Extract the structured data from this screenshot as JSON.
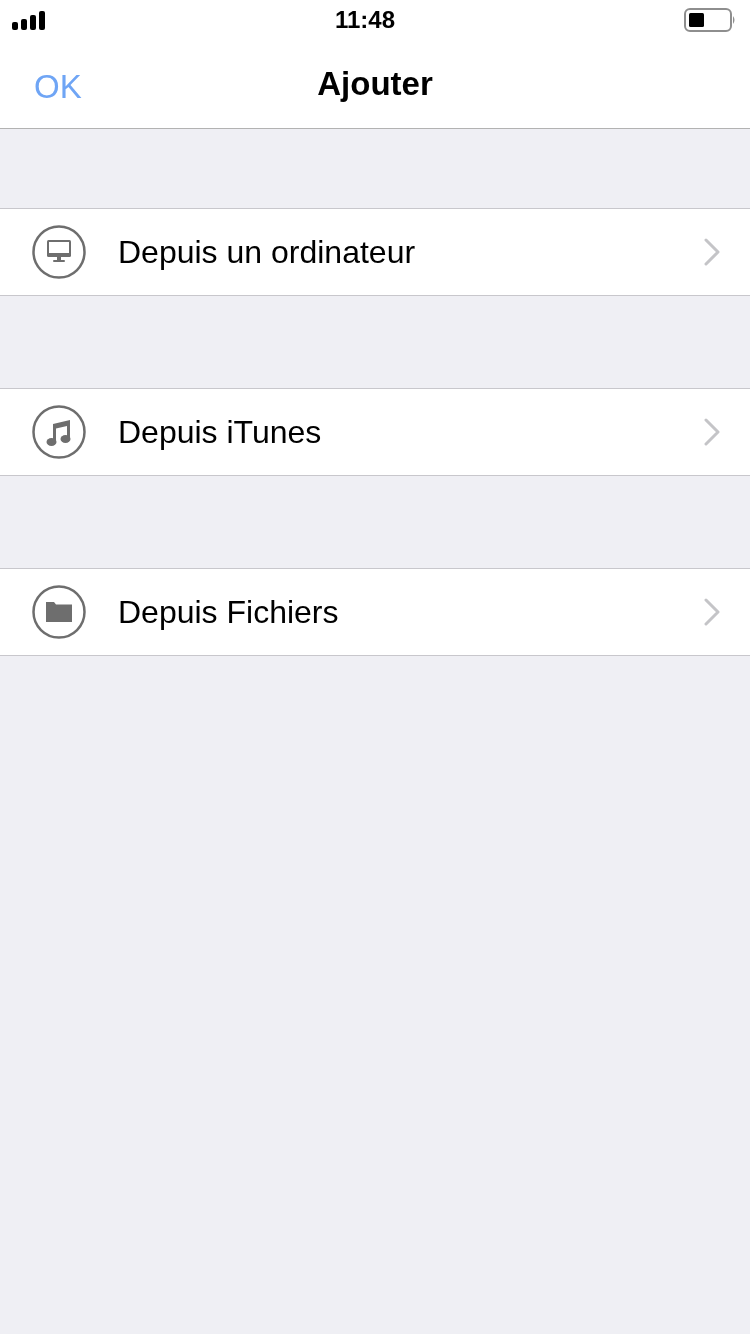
{
  "status_bar": {
    "time": "11:48"
  },
  "nav_bar": {
    "left_button": "OK",
    "title": "Ajouter"
  },
  "items": [
    {
      "kind": "computer",
      "label": "Depuis un ordinateur"
    },
    {
      "kind": "music",
      "label": "Depuis iTunes"
    },
    {
      "kind": "folder",
      "label": "Depuis Fichiers"
    }
  ]
}
